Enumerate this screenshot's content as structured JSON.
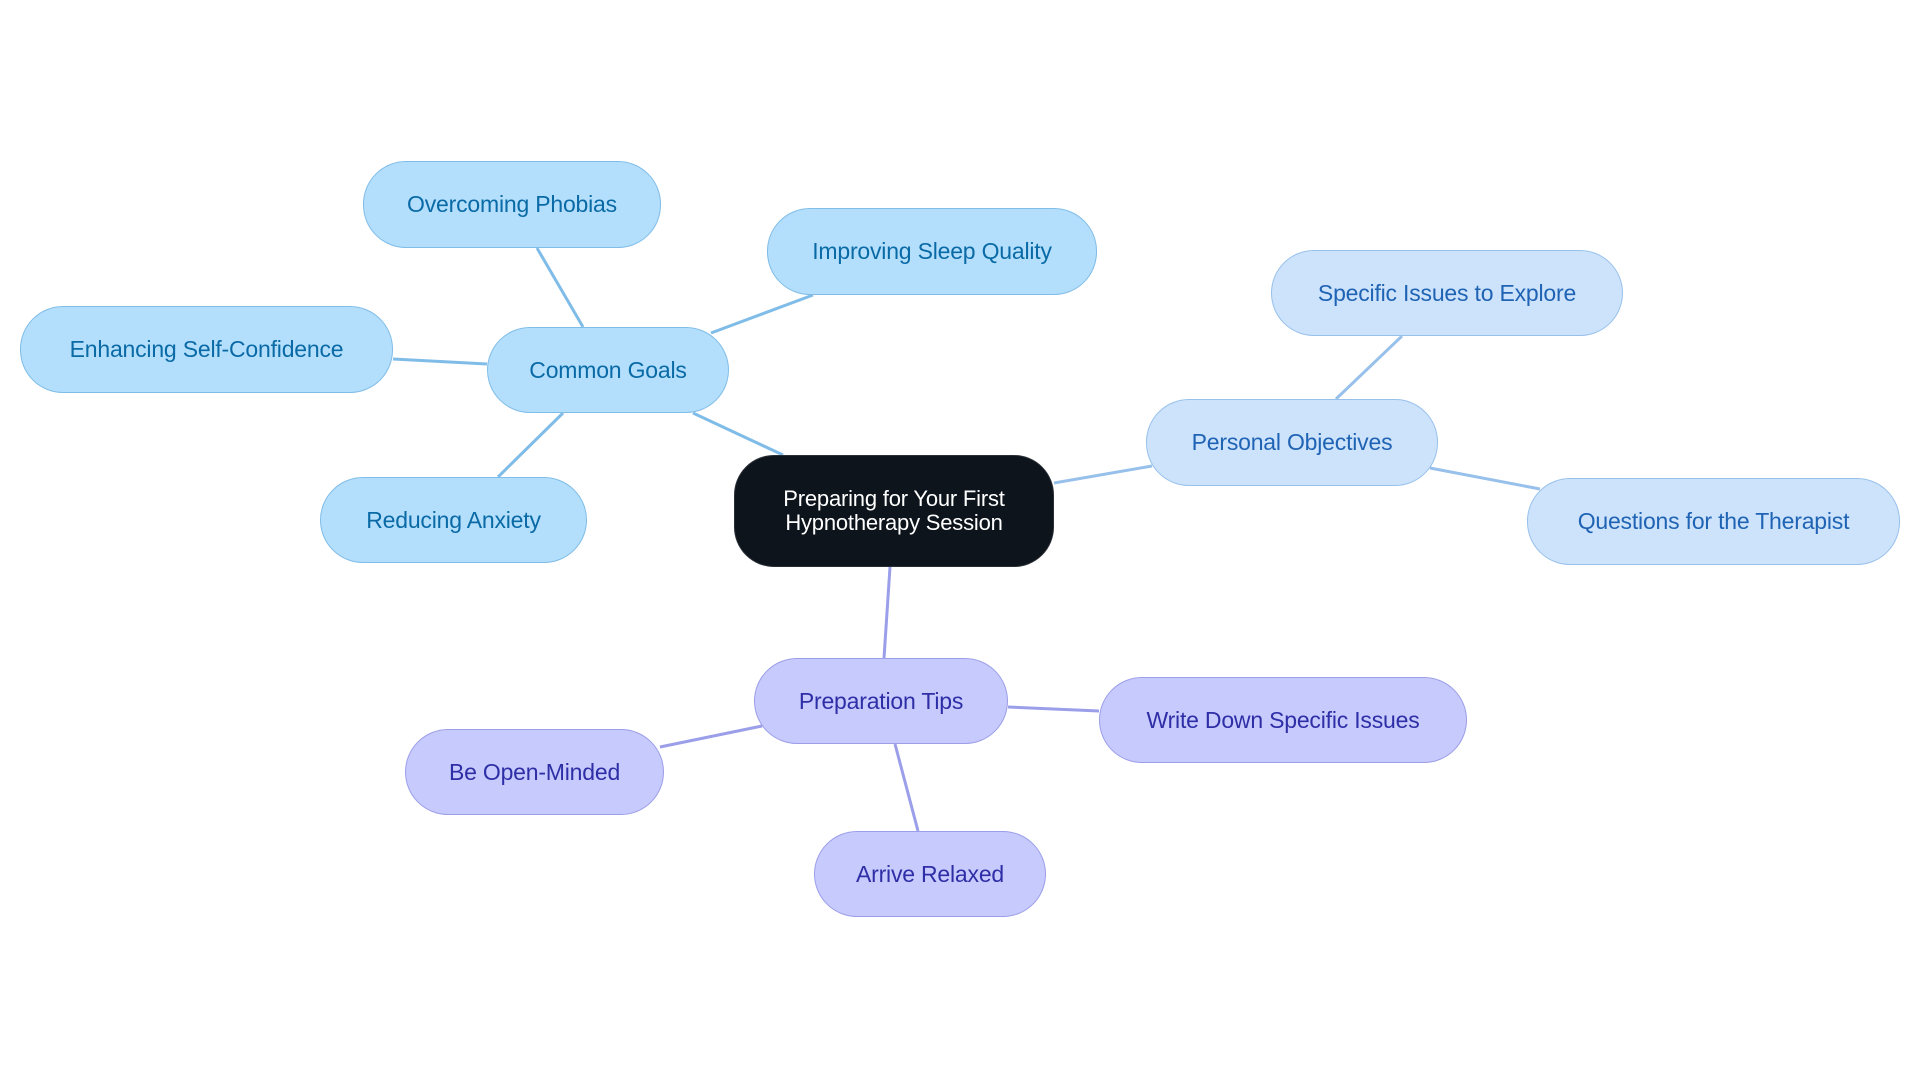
{
  "diagram": {
    "type": "mind-map",
    "root": {
      "id": "root",
      "label": "Preparing for Your First Hypnotherapy Session",
      "line1": "Preparing for Your First",
      "line2": "Hypnotherapy Session"
    },
    "branches": [
      {
        "id": "goals",
        "label": "Common Goals",
        "theme": "goals",
        "children": [
          {
            "id": "phobias",
            "label": "Overcoming Phobias"
          },
          {
            "id": "sleep",
            "label": "Improving Sleep Quality"
          },
          {
            "id": "confidence",
            "label": "Enhancing Self-Confidence"
          },
          {
            "id": "anxiety",
            "label": "Reducing Anxiety"
          }
        ]
      },
      {
        "id": "personal",
        "label": "Personal Objectives",
        "theme": "personal",
        "children": [
          {
            "id": "issues",
            "label": "Specific Issues to Explore"
          },
          {
            "id": "questions",
            "label": "Questions for the Therapist"
          }
        ]
      },
      {
        "id": "prep",
        "label": "Preparation Tips",
        "theme": "prep",
        "children": [
          {
            "id": "write",
            "label": "Write Down Specific Issues"
          },
          {
            "id": "open",
            "label": "Be Open-Minded"
          },
          {
            "id": "relaxed",
            "label": "Arrive Relaxed"
          }
        ]
      }
    ],
    "colors": {
      "root_fill": "#0d141c",
      "goals_fill": "#b3dffc",
      "goals_text": "#0a6aa6",
      "goals_edge": "#7fbce8",
      "personal_fill": "#cde3fb",
      "personal_text": "#1f63b4",
      "personal_edge": "#97c0eb",
      "prep_fill": "#c7cafd",
      "prep_text": "#2e2ea6",
      "prep_edge": "#9b9ee8"
    }
  }
}
